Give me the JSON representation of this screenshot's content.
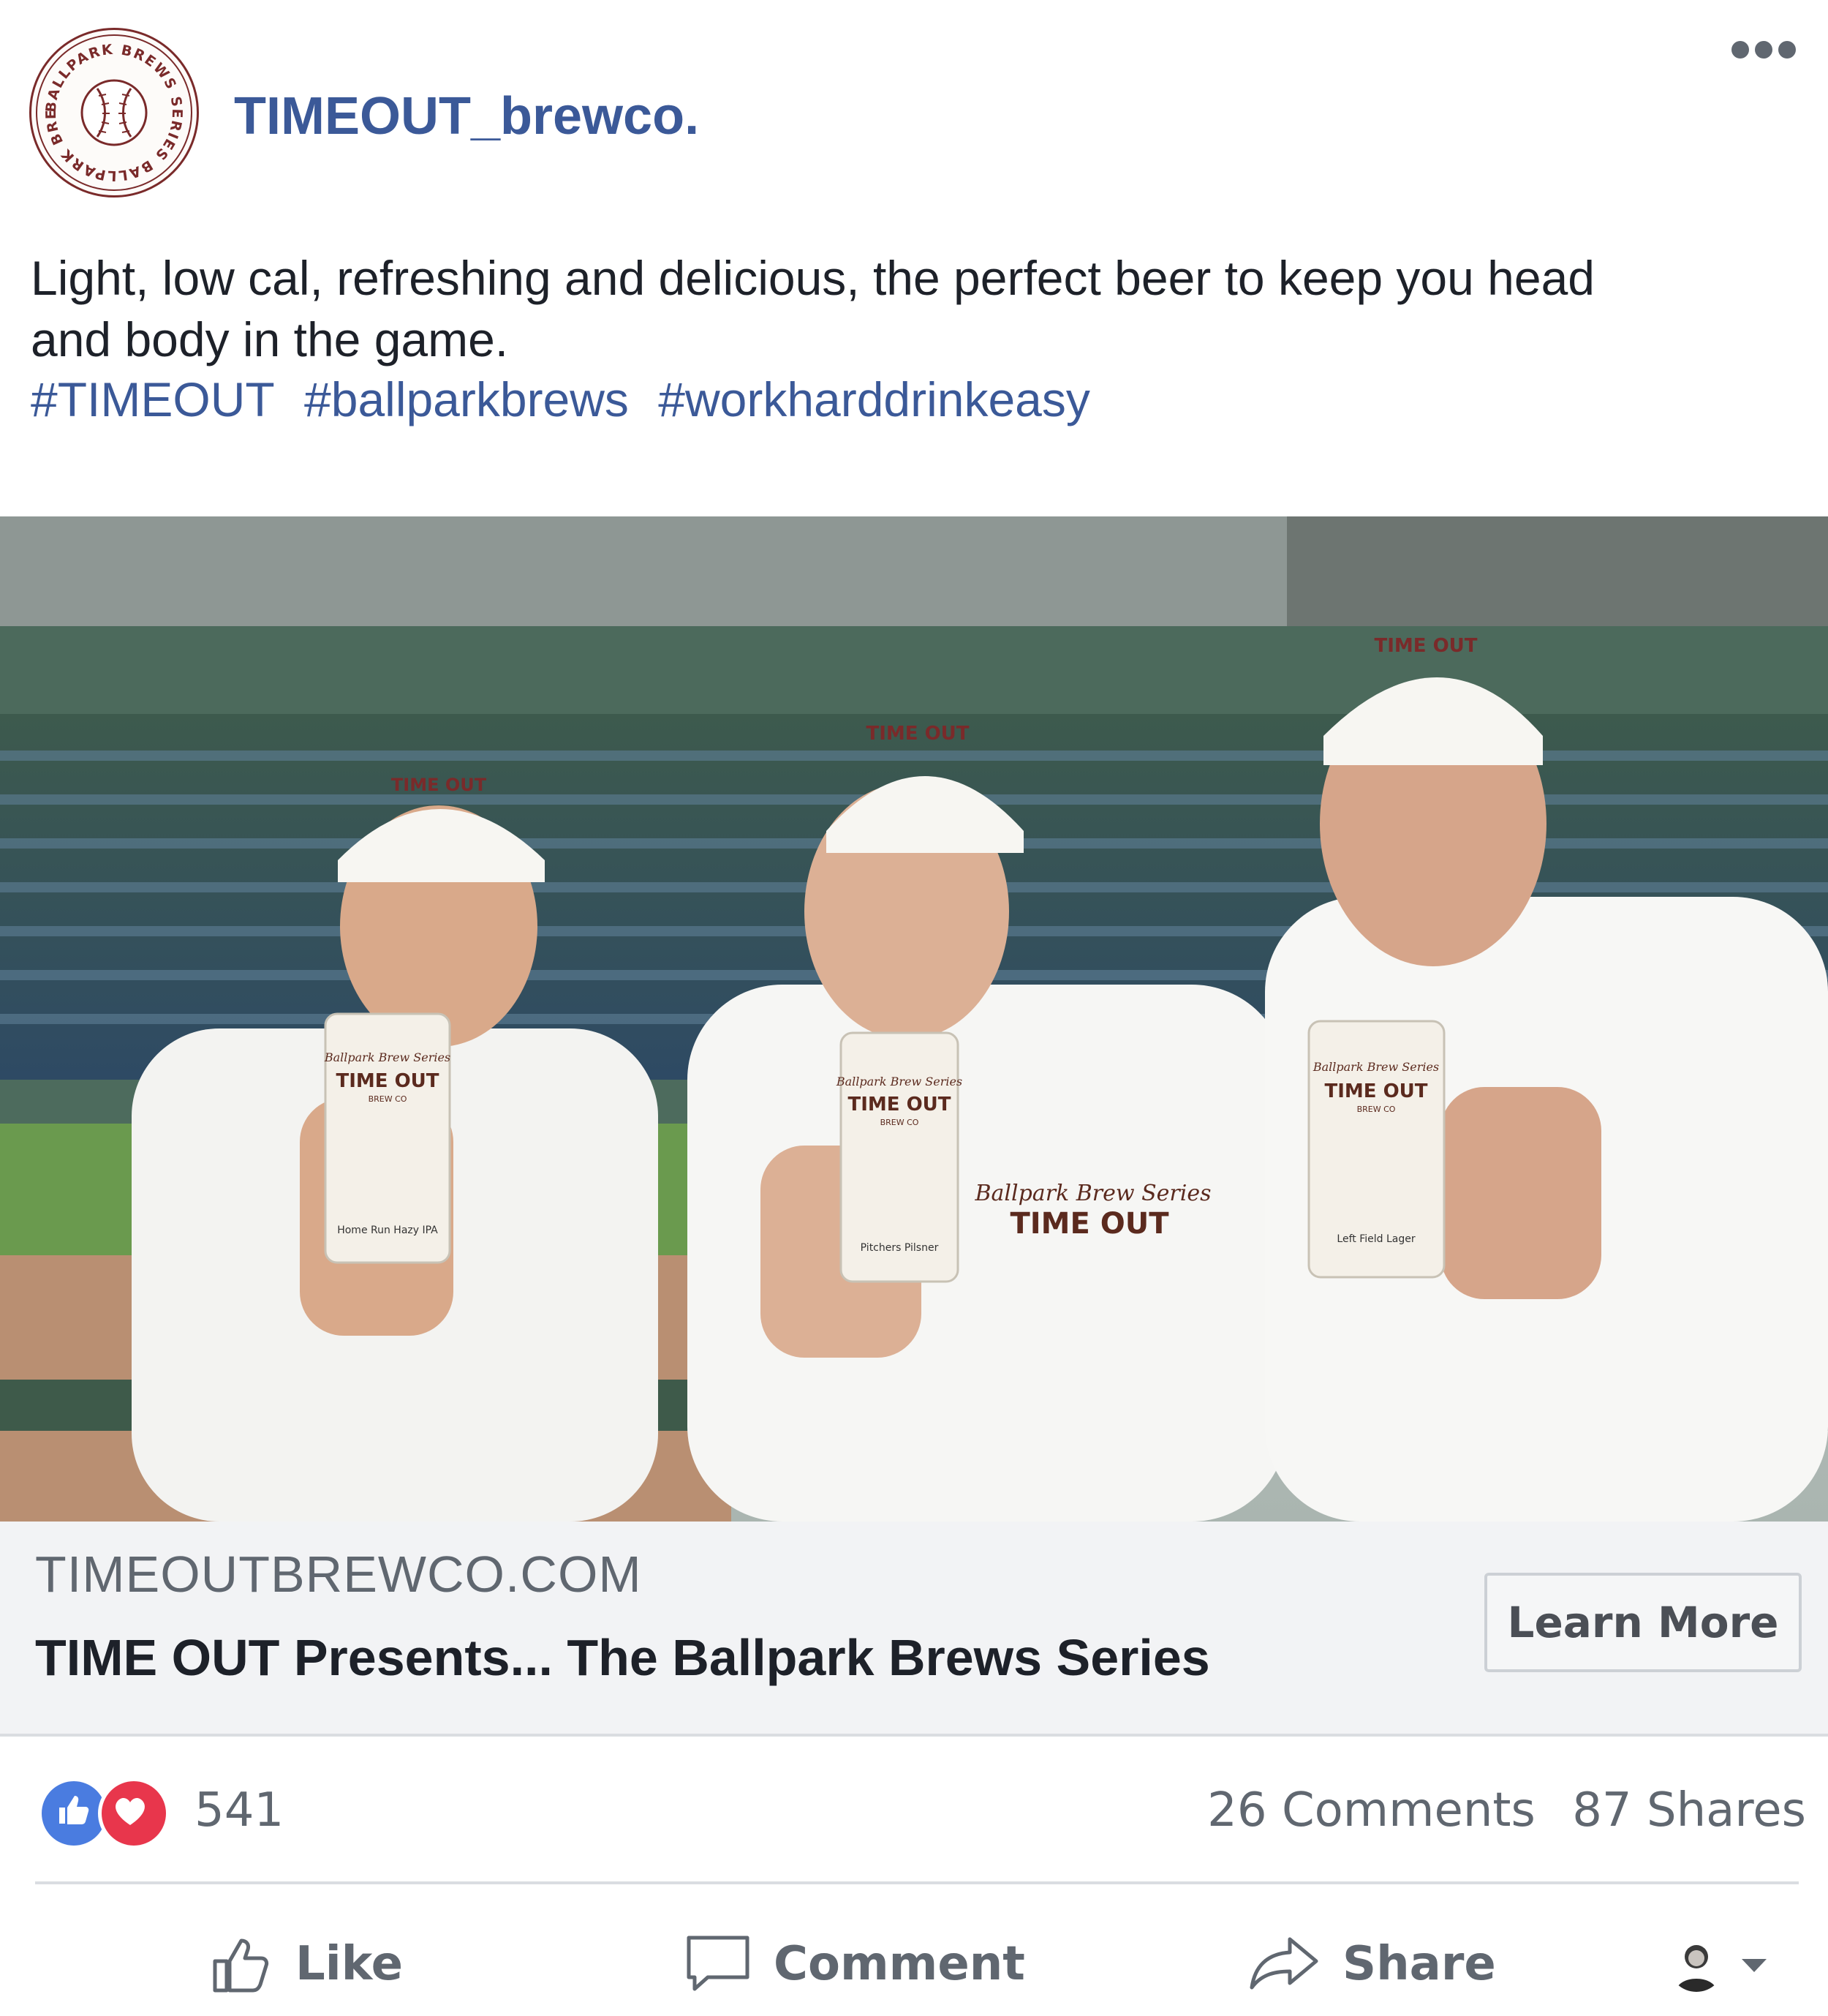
{
  "post": {
    "page_name": "TIMEOUT_brewco.",
    "avatar": {
      "ring_text": "BALLPARK BREWS SERIES BALLPARK BREWS SERIES",
      "icon": "baseball-logo",
      "color": "#7a2a2a"
    },
    "more_icon": "ellipsis-icon",
    "caption": "Light, low cal, refreshing and delicious, the perfect beer to keep you head and body in the game.",
    "hashtags": [
      "#TIMEOUT",
      "#ballparkbrews",
      "#workharddrinkeasy"
    ],
    "link_color": "#3b5998"
  },
  "photo": {
    "cap_label": "TIME OUT",
    "cap_script": "Ballpark Brew Series",
    "cans": [
      {
        "script": "Ballpark Brew Series",
        "brand": "TIME OUT",
        "sub": "BREW CO",
        "name": "Home Run Hazy IPA"
      },
      {
        "script": "Ballpark Brew Series",
        "brand": "TIME OUT",
        "sub": "BREW CO",
        "name": "Pitchers Pilsner"
      },
      {
        "script": "Ballpark Brew Series",
        "brand": "TIME OUT",
        "sub": "BREW CO",
        "name": "Left Field Lager"
      }
    ],
    "jersey_script": "Ballpark Brew Series",
    "jersey_brand": "TIME OUT"
  },
  "link_preview": {
    "domain": "TIMEOUTBREWCO.COM",
    "title": "TIME OUT Presents... The Ballpark Brews Series",
    "cta": "Learn More"
  },
  "engagement": {
    "reactions": [
      "like-reaction-icon",
      "love-reaction-icon"
    ],
    "reaction_count": "541",
    "comments": "26 Comments",
    "shares": "87 Shares"
  },
  "actions": {
    "like": "Like",
    "comment": "Comment",
    "share": "Share"
  }
}
